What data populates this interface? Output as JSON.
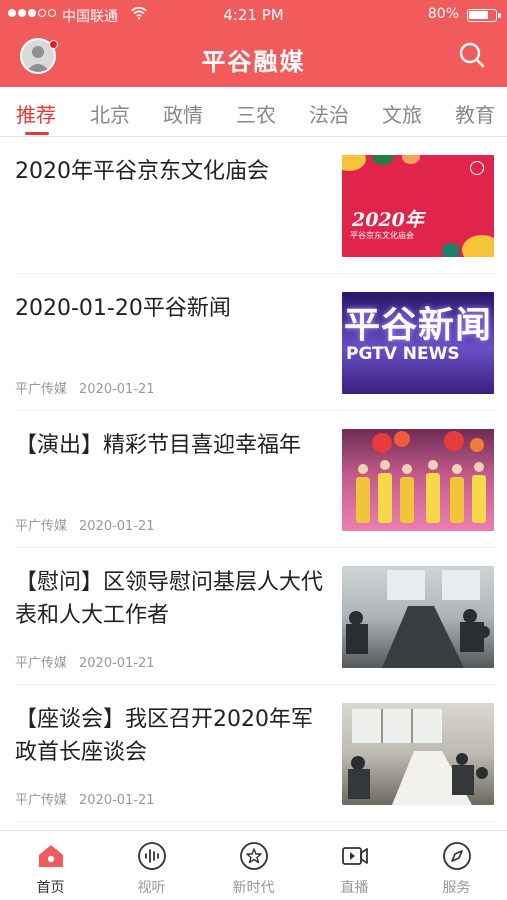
{
  "status_bar": {
    "carrier": "中国联通",
    "time": "4:21 PM",
    "battery": "80%"
  },
  "header": {
    "title": "平谷融媒"
  },
  "tabs": [
    {
      "label": "推荐",
      "active": true
    },
    {
      "label": "北京",
      "active": false
    },
    {
      "label": "政情",
      "active": false
    },
    {
      "label": "三农",
      "active": false
    },
    {
      "label": "法治",
      "active": false
    },
    {
      "label": "文旅",
      "active": false
    },
    {
      "label": "教育",
      "active": false
    }
  ],
  "news": [
    {
      "title": "2020年平谷京东文化庙会",
      "source": "",
      "date": "",
      "thumb_text": "2020年",
      "thumb_subtext": "平谷京东文化庙会"
    },
    {
      "title": "2020-01-20平谷新闻",
      "source": "平广传媒",
      "date": "2020-01-21",
      "thumb_text": "平谷新闻",
      "thumb_subtext": "PGTV NEWS"
    },
    {
      "title": "【演出】精彩节目喜迎幸福年",
      "source": "平广传媒",
      "date": "2020-01-21"
    },
    {
      "title": "【慰问】区领导慰问基层人大代表和人大工作者",
      "source": "平广传媒",
      "date": "2020-01-21"
    },
    {
      "title": "【座谈会】我区召开2020年军政首长座谈会",
      "source": "平广传媒",
      "date": "2020-01-21"
    }
  ],
  "bottom_nav": [
    {
      "label": "首页",
      "icon": "home-icon",
      "active": true
    },
    {
      "label": "视听",
      "icon": "audio-icon",
      "active": false
    },
    {
      "label": "新时代",
      "icon": "star-icon",
      "active": false
    },
    {
      "label": "直播",
      "icon": "live-video-icon",
      "active": false
    },
    {
      "label": "服务",
      "icon": "compass-icon",
      "active": false
    }
  ],
  "colors": {
    "brand": "#f15b5b",
    "accent": "#e63a3a",
    "muted": "#999999"
  }
}
